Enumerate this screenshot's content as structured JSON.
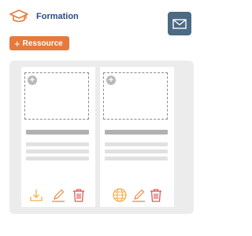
{
  "header": {
    "title": "Formation",
    "icon": "graduation-cap-icon"
  },
  "toolbar": {
    "add_label": "Ressource",
    "add_icon": "+",
    "mail_icon": "envelope-icon"
  },
  "cards": [
    {
      "add_icon": "+",
      "actions": [
        "download-icon",
        "edit-icon",
        "trash-icon"
      ]
    },
    {
      "add_icon": "+",
      "actions": [
        "globe-icon",
        "edit-icon",
        "trash-icon"
      ]
    }
  ],
  "colors": {
    "title": "#2c4c86",
    "accent": "#e57a3c",
    "mail_button": "#4b6a84",
    "download": "#f0b04a",
    "edit": "#e58a4a",
    "trash": "#e05a5a",
    "globe": "#f0b04a"
  }
}
